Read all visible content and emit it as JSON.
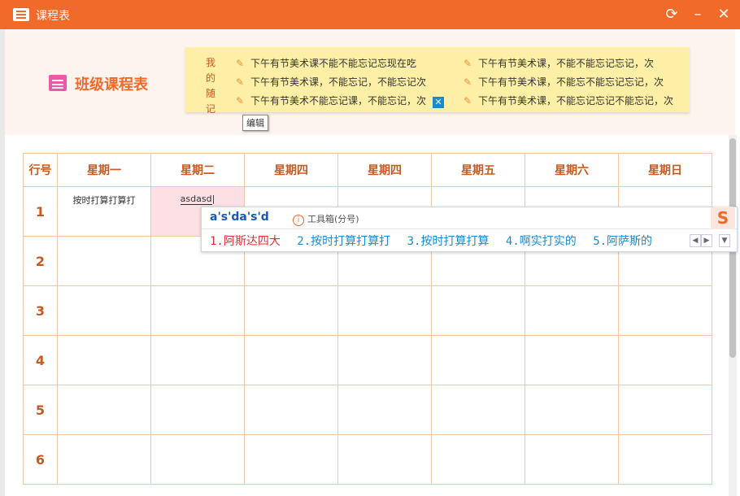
{
  "window": {
    "title": "课程表"
  },
  "brand": {
    "title": "班级课程表"
  },
  "notes": {
    "heading": [
      "我",
      "的",
      "随",
      "记"
    ],
    "items": [
      "下午有节美术课不能不能忘记忘现在吃",
      "下午有节美术课，不能忘记，不能忘记次",
      "下午有节美术不能忘记课，不能忘记，次",
      "下午有节美术课，不能不能忘记忘记，次",
      "下午有节美术课，不能忘不能忘记忘记，次",
      "下午有节美术课，不能忘记忘记不能忘记，次"
    ],
    "edit_tooltip": "编辑"
  },
  "schedule": {
    "headers": [
      "行号",
      "星期一",
      "星期二",
      "星期四",
      "星期四",
      "星期五",
      "星期六",
      "星期日"
    ],
    "rows": [
      "1",
      "2",
      "3",
      "4",
      "5",
      "6"
    ],
    "cell_r1_mon": "按时打算打算打",
    "cell_r1_tue": "asdasd"
  },
  "ime": {
    "composition": "a's'da's'd",
    "toolbox": "工具箱(分号)",
    "candidates": [
      "1.阿斯达四大",
      "2.按时打算打算打",
      "3.按时打算打算",
      "4.啊实打实的",
      "5.阿萨斯的"
    ]
  },
  "colors": {
    "accent": "#f26a2a",
    "notes_bg": "#fdf0a6",
    "border": "#f2c7a8"
  }
}
